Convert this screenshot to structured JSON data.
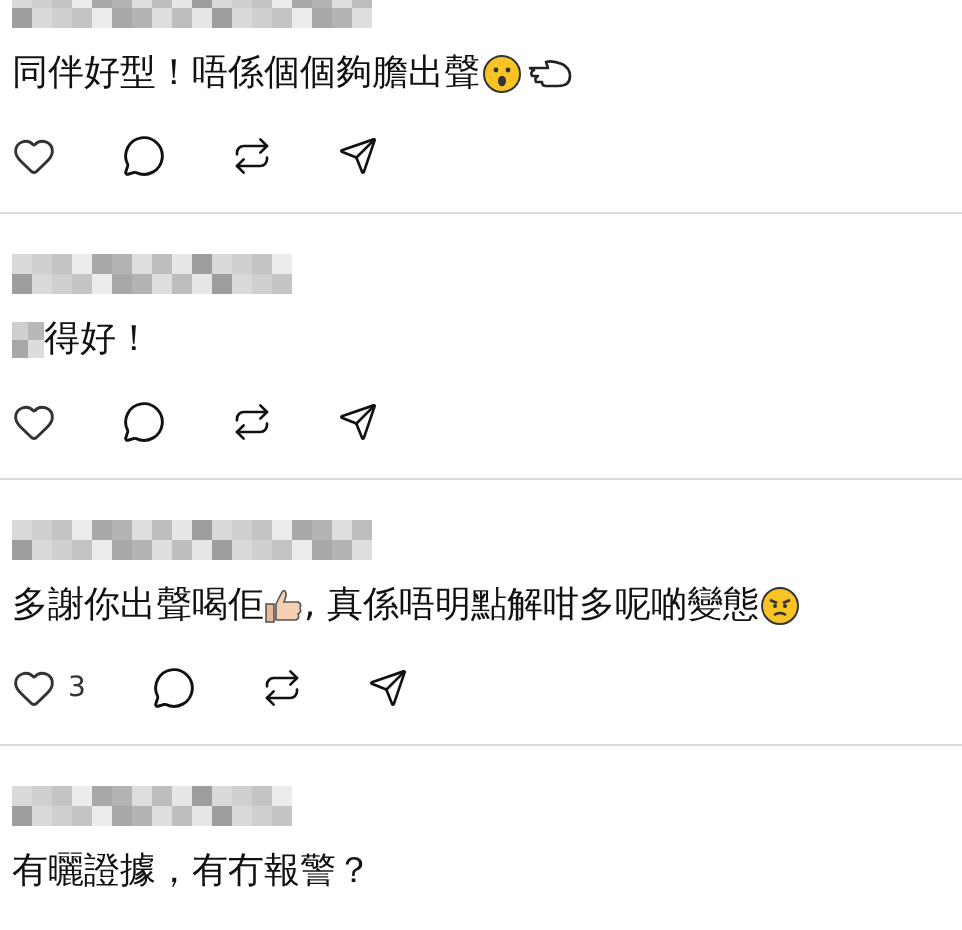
{
  "comments": [
    {
      "parts": [
        {
          "kind": "text",
          "text": "同伴好型！唔係個個夠膽出聲"
        },
        {
          "kind": "surprised-face"
        },
        {
          "kind": "pointing-hand"
        }
      ]
    },
    {
      "parts": [
        {
          "kind": "redacted"
        },
        {
          "kind": "text",
          "text": "得好！"
        }
      ]
    },
    {
      "parts": [
        {
          "kind": "text",
          "text": "多謝你出聲喝佢"
        },
        {
          "kind": "thumbs-up"
        },
        {
          "kind": "text",
          "text": ", 真係唔明點解咁多呢啲變態"
        },
        {
          "kind": "angry-face"
        }
      ],
      "like_count": "3"
    },
    {
      "parts": [
        {
          "kind": "text",
          "text": "有曬證據，有冇報警？"
        }
      ]
    }
  ]
}
